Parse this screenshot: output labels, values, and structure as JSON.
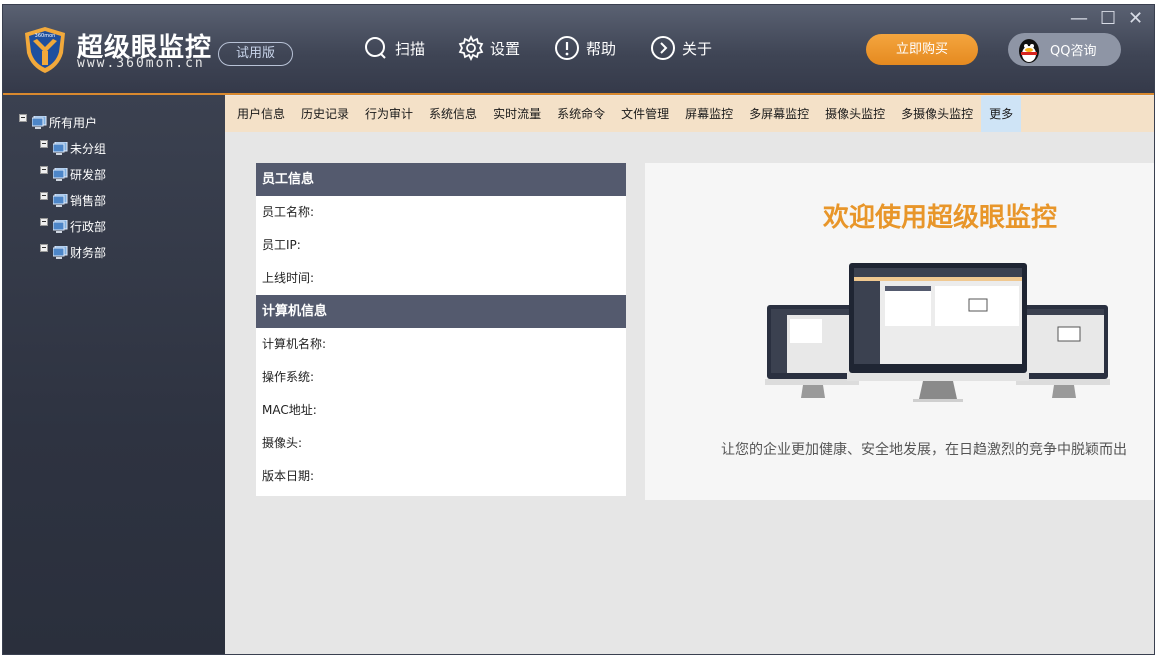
{
  "app": {
    "title": "超级眼监控",
    "url": "www.360mon.cn",
    "edition": "试用版",
    "logo_text": "360mon"
  },
  "topnav": {
    "scan": "扫描",
    "settings": "设置",
    "help": "帮助",
    "about": "关于"
  },
  "actions": {
    "buy": "立即购买",
    "qq": "QQ咨询"
  },
  "sidebar": {
    "root": "所有用户",
    "groups": [
      "未分组",
      "研发部",
      "销售部",
      "行政部",
      "财务部"
    ]
  },
  "tabs": [
    "用户信息",
    "历史记录",
    "行为审计",
    "系统信息",
    "实时流量",
    "系统命令",
    "文件管理",
    "屏幕监控",
    "多屏幕监控",
    "摄像头监控",
    "多摄像头监控",
    "更多"
  ],
  "active_tab": "更多",
  "employee_info": {
    "heading": "员工信息",
    "name_label": "员工名称:",
    "ip_label": "员工IP:",
    "online_label": "上线时间:"
  },
  "computer_info": {
    "heading": "计算机信息",
    "name_label": "计算机名称:",
    "os_label": "操作系统:",
    "mac_label": "MAC地址:",
    "camera_label": "摄像头:",
    "version_label": "版本日期:"
  },
  "welcome": {
    "title": "欢迎使用超级眼监控",
    "tagline": "让您的企业更加健康、安全地发展，在日趋激烈的竞争中脱颖而出"
  },
  "colors": {
    "accent": "#e8962a",
    "header_bg": "#454b5b",
    "sidebar_bg": "#2e3341",
    "tabbar_bg": "#f4e1c8",
    "section_head": "#545a6e"
  }
}
